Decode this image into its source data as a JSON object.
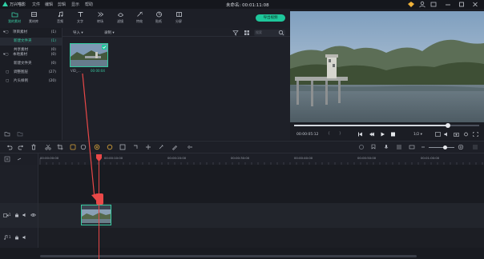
{
  "titlebar": {
    "app_name": "万兴喵影",
    "menus": [
      "文件",
      "编辑",
      "剪辑",
      "显示",
      "帮助"
    ],
    "project_title": "未命名: 00:01:11:08"
  },
  "toolbar": {
    "tools": [
      {
        "label": "我的素材",
        "icon": "folder-icon"
      },
      {
        "label": "素材库",
        "icon": "library-icon"
      },
      {
        "label": "音频",
        "icon": "music-note-icon"
      },
      {
        "label": "文字",
        "icon": "text-icon"
      },
      {
        "label": "转场",
        "icon": "transition-icon"
      },
      {
        "label": "滤镜",
        "icon": "filter-icon"
      },
      {
        "label": "特效",
        "icon": "effects-icon"
      },
      {
        "label": "贴纸",
        "icon": "sticker-icon"
      },
      {
        "label": "分屏",
        "icon": "split-screen-icon"
      }
    ],
    "export_label": "导出视频"
  },
  "sidebar": {
    "items": [
      {
        "label": "项目素材",
        "count": "(1)",
        "indent": 0
      },
      {
        "label": "新建文件夹",
        "count": "(1)",
        "indent": 1,
        "selected": true
      },
      {
        "label": "共享素材",
        "count": "(0)",
        "indent": 0
      },
      {
        "label": "本地素材",
        "count": "(0)",
        "indent": 0
      },
      {
        "label": "新建文件夹",
        "count": "(0)",
        "indent": 1
      },
      {
        "label": "调整图层",
        "count": "(27)",
        "indent": 0
      },
      {
        "label": "片头样例",
        "count": "(20)",
        "indent": 0
      }
    ]
  },
  "media": {
    "import_label": "导入",
    "record_label": "录制",
    "search_placeholder": "搜索",
    "clip_name": "VID_...",
    "clip_duration": "00:00:04"
  },
  "preview": {
    "current_time": "00:00:05:12",
    "zoom": "1/2",
    "progress": 0.83
  },
  "timeline": {
    "ruler_labels": [
      "00:00:00:00",
      "00:00:10:00",
      "00:00:20:00",
      "00:00:30:00",
      "00:00:40:00",
      "00:00:50:00",
      "00:01:00:00"
    ],
    "video_track": "1",
    "audio_track": "1"
  },
  "colors": {
    "accent": "#1ec79b",
    "playhead": "#e94848"
  }
}
